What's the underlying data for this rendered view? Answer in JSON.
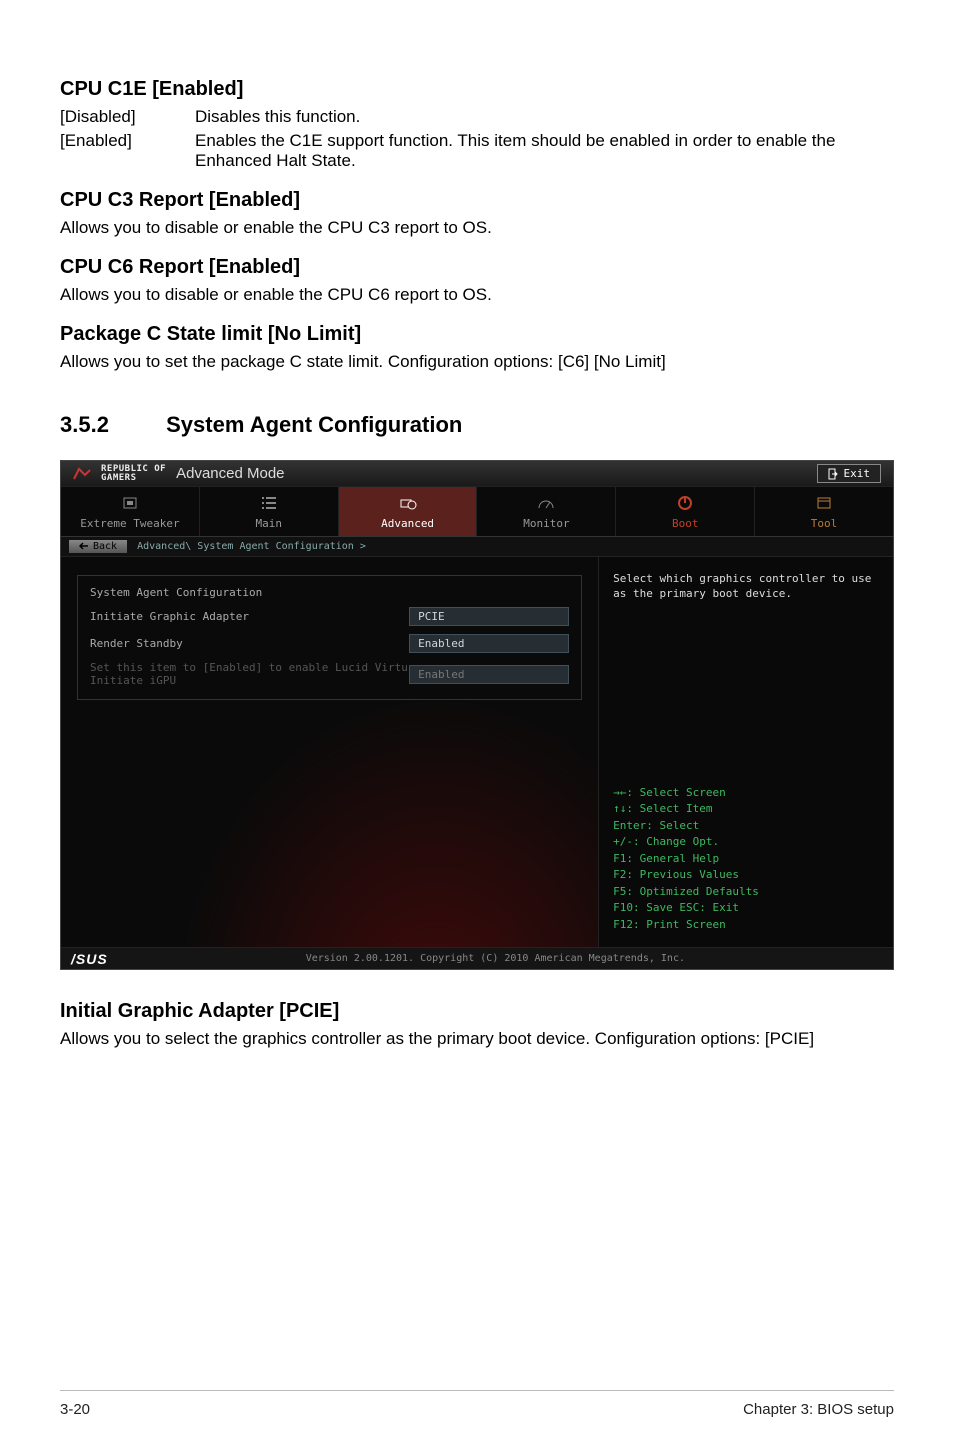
{
  "doc": {
    "h_cpu_c1e": "CPU C1E [Enabled]",
    "c1e_disabled_key": "[Disabled]",
    "c1e_disabled_desc": "Disables this function.",
    "c1e_enabled_key": "[Enabled]",
    "c1e_enabled_desc": "Enables the C1E support function. This item should be enabled in order to enable the Enhanced Halt State.",
    "h_cpu_c3": "CPU C3 Report [Enabled]",
    "c3_desc": "Allows you to disable or enable the CPU C3 report to OS.",
    "h_cpu_c6": "CPU C6 Report [Enabled]",
    "c6_desc": "Allows you to disable or enable the CPU C6 report to OS.",
    "h_pkg_c": "Package C State limit [No Limit]",
    "pkg_c_desc": "Allows you to set the package C state limit. Configuration options: [C6] [No Limit]",
    "section_no": "3.5.2",
    "section_title": "System Agent Configuration",
    "h_iga": "Initial Graphic Adapter [PCIE]",
    "iga_desc": "Allows you to select the graphics controller as the primary boot device. Configuration options: [PCIE]",
    "page_l": "3-20",
    "page_r": "Chapter 3: BIOS setup"
  },
  "bios": {
    "rog1": "REPUBLIC OF",
    "rog2": "GAMERS",
    "mode": "Advanced Mode",
    "exit": "Exit",
    "tabs": {
      "extreme": "Extreme Tweaker",
      "main": "Main",
      "advanced": "Advanced",
      "monitor": "Monitor",
      "boot": "Boot",
      "tool": "Tool"
    },
    "back": "Back",
    "breadcrumb": "Advanced\\ System Agent Configuration >",
    "grp_title": "System Agent Configuration",
    "row_iga_label": "Initiate Graphic Adapter",
    "row_iga_value": "PCIE",
    "row_rs_label": "Render Standby",
    "row_rs_value": "Enabled",
    "hint": "Set this item to [Enabled] to enable Lucid Virtu",
    "row_igpu_label": "Initiate iGPU",
    "row_igpu_value": "Enabled",
    "help": "Select which graphics controller to use as the primary boot device.",
    "keys": "→←: Select Screen\n↑↓: Select Item\nEnter: Select\n+/-: Change Opt.\nF1: General Help\nF2: Previous Values\nF5: Optimized Defaults\nF10: Save  ESC: Exit\nF12: Print Screen",
    "brand": "/SUS",
    "copyright": "Version 2.00.1201. Copyright (C) 2010 American Megatrends, Inc."
  }
}
